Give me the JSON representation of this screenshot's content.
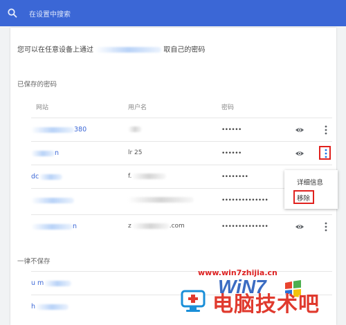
{
  "search": {
    "placeholder": "在设置中搜索"
  },
  "info_text_prefix": "您可以在任意设备上通过",
  "info_text_suffix": "取自己的密码",
  "saved_passwords": {
    "title": "已保存的密码",
    "columns": {
      "site": "网站",
      "username": "用户名",
      "password": "密码"
    },
    "rows": [
      {
        "site": "380",
        "user": "",
        "password": "••••••"
      },
      {
        "site": "n",
        "user": "lr   25",
        "password": "••••••"
      },
      {
        "site": "dc",
        "user": "f.",
        "password": "••••••••"
      },
      {
        "site": "",
        "user": "",
        "password": "••••••••••••••"
      },
      {
        "site": "n",
        "user": "z",
        "password": "••••••••••••••"
      }
    ]
  },
  "menu": {
    "details": "详细信息",
    "remove": "移除"
  },
  "never_saved": {
    "title": "一律不保存",
    "rows": [
      {
        "site": "u   m"
      },
      {
        "site": "h"
      }
    ]
  },
  "watermark": {
    "url": "www.win7zhijia.cn",
    "title": "电脑技术吧",
    "win_logo": "WiN7"
  },
  "colors": {
    "accent": "#3b67d6",
    "highlight": "#e0211e"
  }
}
